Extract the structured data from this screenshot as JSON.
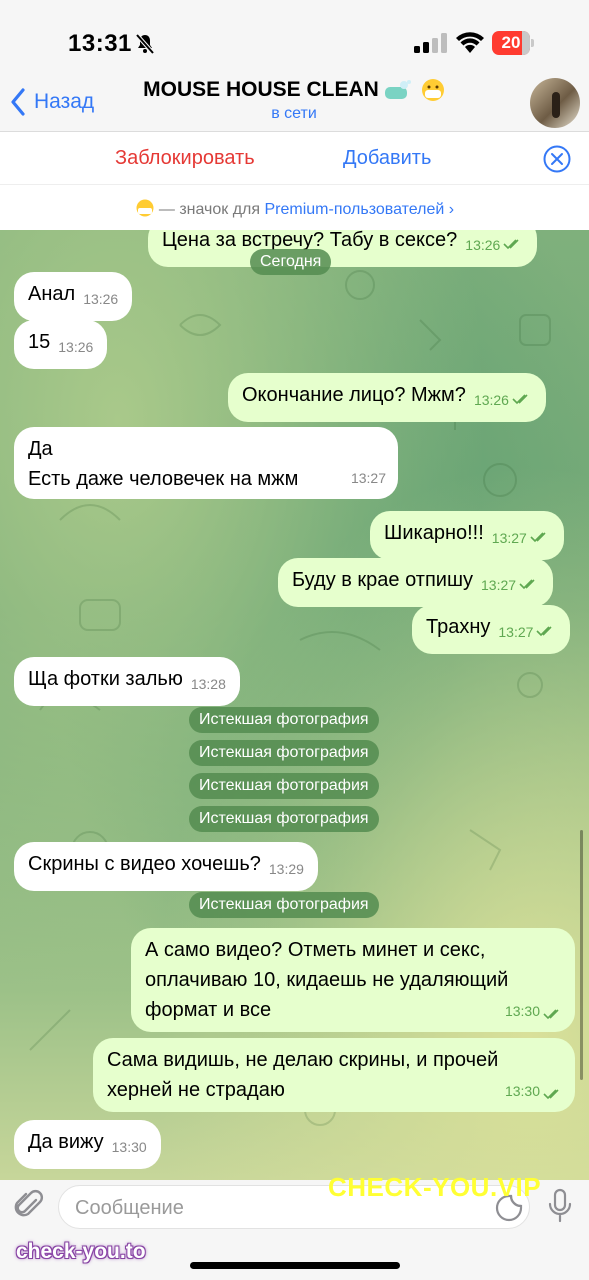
{
  "status_bar": {
    "time": "13:31",
    "battery": "20"
  },
  "header": {
    "back_label": "Назад",
    "chat_title": "MOUSE HOUSE CLEAN",
    "chat_status": "в сети"
  },
  "actions": {
    "block_label": "Заблокировать",
    "add_label": "Добавить"
  },
  "premium_note": {
    "text": "— значок для ",
    "link": "Premium-пользователей"
  },
  "messages": [
    {
      "dir": "out",
      "text": "Цена за встречу? Табу в сексе?",
      "time": "13:26"
    },
    {
      "dir": "system",
      "text": "Сегодня"
    },
    {
      "dir": "in",
      "text": "Анал",
      "time": "13:26"
    },
    {
      "dir": "in",
      "text": "15",
      "time": "13:26"
    },
    {
      "dir": "out",
      "text": "Окончание лицо? Мжм?",
      "time": "13:26"
    },
    {
      "dir": "in",
      "line1": "Да",
      "line2": "Есть даже человечек на мжм",
      "time": "13:27"
    },
    {
      "dir": "out",
      "text": "Шикарно!!!",
      "time": "13:27"
    },
    {
      "dir": "out",
      "text": "Буду в крае отпишу",
      "time": "13:27"
    },
    {
      "dir": "out",
      "text": "Трахну",
      "time": "13:27"
    },
    {
      "dir": "in",
      "text": "Ща фотки залью",
      "time": "13:28"
    },
    {
      "dir": "system",
      "text": "Истекшая фотография"
    },
    {
      "dir": "system",
      "text": "Истекшая фотография"
    },
    {
      "dir": "system",
      "text": "Истекшая фотография"
    },
    {
      "dir": "system",
      "text": "Истекшая фотография"
    },
    {
      "dir": "in",
      "text": "Скрины с видео хочешь?",
      "time": "13:29"
    },
    {
      "dir": "system",
      "text": "Истекшая фотография"
    },
    {
      "dir": "out",
      "line1": "А само видео? Отметь минет и секс,",
      "line2": "оплачиваю 10, кидаешь не удаляющий",
      "line3": "формат и все",
      "time": "13:30"
    },
    {
      "dir": "out",
      "line1": "Сама видишь, не делаю скрины, и прочей",
      "line2": "херней не страдаю",
      "time": "13:30"
    },
    {
      "dir": "in",
      "text": "Да вижу",
      "time": "13:30"
    }
  ],
  "input": {
    "placeholder": "Сообщение"
  },
  "watermarks": {
    "top": "CHECK-YOU.VIP",
    "bottom": "check-you.to"
  },
  "colors": {
    "accent": "#3478f6",
    "danger": "#e53935",
    "outgoing_bubble": "#e6ffcd",
    "incoming_bubble": "#ffffff"
  }
}
